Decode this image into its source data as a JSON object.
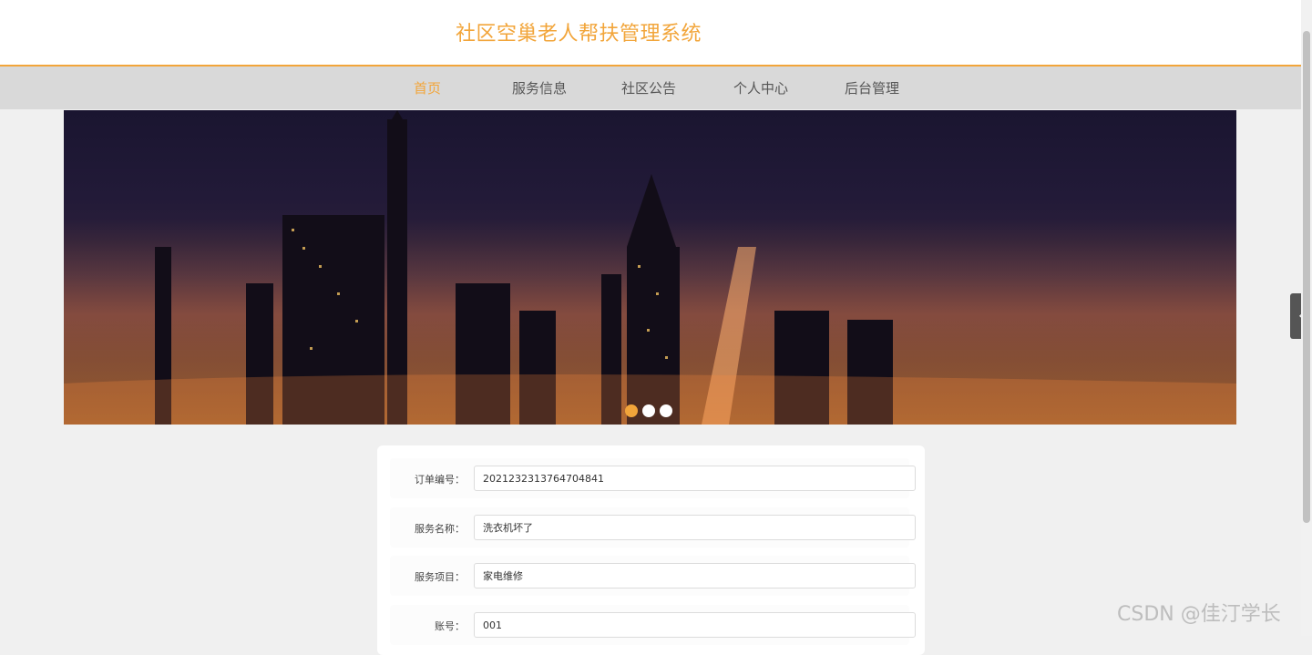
{
  "header": {
    "title": "社区空巢老人帮扶管理系统"
  },
  "nav": {
    "items": [
      {
        "label": "首页",
        "active": true
      },
      {
        "label": "服务信息",
        "active": false
      },
      {
        "label": "社区公告",
        "active": false
      },
      {
        "label": "个人中心",
        "active": false
      },
      {
        "label": "后台管理",
        "active": false
      }
    ]
  },
  "banner": {
    "icon": "city-night-skyline-image",
    "slides": 3,
    "active_slide": 1
  },
  "side_toggle": {
    "icon": "chevron-left-icon",
    "glyph": "‹"
  },
  "form": {
    "fields": [
      {
        "label": "订单编号：",
        "value": "2021232313764704841"
      },
      {
        "label": "服务名称：",
        "value": "洗衣机坏了"
      },
      {
        "label": "服务项目：",
        "value": "家电维修"
      },
      {
        "label": "账号：",
        "value": "001"
      }
    ]
  },
  "watermark": {
    "text": "CSDN @佳汀学长"
  },
  "colors": {
    "accent": "#f2a53a",
    "nav_bg": "#d9d9d9",
    "page_bg": "#f0f0f0"
  }
}
